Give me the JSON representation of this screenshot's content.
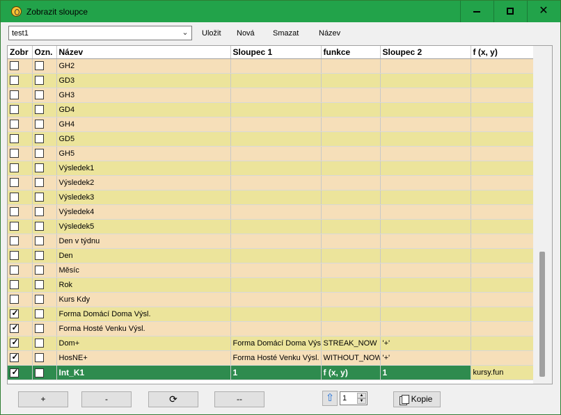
{
  "window": {
    "title": "Zobrazit sloupce"
  },
  "toolbar": {
    "combo_value": "test1",
    "save_label": "Uložit",
    "new_label": "Nová",
    "delete_label": "Smazat",
    "rename_label": "Název"
  },
  "table": {
    "headers": [
      "Zobr",
      "Ozn.",
      "Název",
      "Sloupec 1",
      "funkce",
      "Sloupec 2",
      "f (x, y)"
    ],
    "rows": [
      {
        "zobr": false,
        "ozn": false,
        "nazev": "GH2",
        "s1": "",
        "f": "",
        "s2": "",
        "fxy": ""
      },
      {
        "zobr": false,
        "ozn": false,
        "nazev": "GD3",
        "s1": "",
        "f": "",
        "s2": "",
        "fxy": ""
      },
      {
        "zobr": false,
        "ozn": false,
        "nazev": "GH3",
        "s1": "",
        "f": "",
        "s2": "",
        "fxy": ""
      },
      {
        "zobr": false,
        "ozn": false,
        "nazev": "GD4",
        "s1": "",
        "f": "",
        "s2": "",
        "fxy": ""
      },
      {
        "zobr": false,
        "ozn": false,
        "nazev": "GH4",
        "s1": "",
        "f": "",
        "s2": "",
        "fxy": ""
      },
      {
        "zobr": false,
        "ozn": false,
        "nazev": "GD5",
        "s1": "",
        "f": "",
        "s2": "",
        "fxy": ""
      },
      {
        "zobr": false,
        "ozn": false,
        "nazev": "GH5",
        "s1": "",
        "f": "",
        "s2": "",
        "fxy": ""
      },
      {
        "zobr": false,
        "ozn": false,
        "nazev": "Výsledek1",
        "s1": "",
        "f": "",
        "s2": "",
        "fxy": ""
      },
      {
        "zobr": false,
        "ozn": false,
        "nazev": "Výsledek2",
        "s1": "",
        "f": "",
        "s2": "",
        "fxy": ""
      },
      {
        "zobr": false,
        "ozn": false,
        "nazev": "Výsledek3",
        "s1": "",
        "f": "",
        "s2": "",
        "fxy": ""
      },
      {
        "zobr": false,
        "ozn": false,
        "nazev": "Výsledek4",
        "s1": "",
        "f": "",
        "s2": "",
        "fxy": ""
      },
      {
        "zobr": false,
        "ozn": false,
        "nazev": "Výsledek5",
        "s1": "",
        "f": "",
        "s2": "",
        "fxy": ""
      },
      {
        "zobr": false,
        "ozn": false,
        "nazev": "Den v týdnu",
        "s1": "",
        "f": "",
        "s2": "",
        "fxy": ""
      },
      {
        "zobr": false,
        "ozn": false,
        "nazev": "Den",
        "s1": "",
        "f": "",
        "s2": "",
        "fxy": ""
      },
      {
        "zobr": false,
        "ozn": false,
        "nazev": "Měsíc",
        "s1": "",
        "f": "",
        "s2": "",
        "fxy": ""
      },
      {
        "zobr": false,
        "ozn": false,
        "nazev": "Rok",
        "s1": "",
        "f": "",
        "s2": "",
        "fxy": ""
      },
      {
        "zobr": false,
        "ozn": false,
        "nazev": "Kurs Kdy",
        "s1": "",
        "f": "",
        "s2": "",
        "fxy": ""
      },
      {
        "zobr": true,
        "ozn": false,
        "nazev": "Forma Domácí Doma Výsl.",
        "s1": "",
        "f": "",
        "s2": "",
        "fxy": ""
      },
      {
        "zobr": true,
        "ozn": false,
        "nazev": "Forma Hosté Venku Výsl.",
        "s1": "",
        "f": "",
        "s2": "",
        "fxy": ""
      },
      {
        "zobr": true,
        "ozn": false,
        "nazev": "Dom+",
        "s1": "Forma Domácí Doma Výsl.",
        "f": "STREAK_NOW",
        "s2": "'+'",
        "fxy": ""
      },
      {
        "zobr": true,
        "ozn": false,
        "nazev": "HosNE+",
        "s1": "Forma Hosté Venku Výsl.",
        "f": "WITHOUT_NOW",
        "s2": "'+'",
        "fxy": ""
      },
      {
        "zobr": true,
        "ozn": false,
        "nazev": "Int_K1",
        "s1": "1",
        "f": "f (x, y)",
        "s2": "1",
        "fxy": "kursy.fun",
        "selected": true
      }
    ]
  },
  "footer": {
    "add_label": "+",
    "remove_label": "-",
    "refresh_icon": "refresh-icon",
    "separator_label": "--",
    "position_value": "1",
    "copy_label": "Kopie"
  }
}
